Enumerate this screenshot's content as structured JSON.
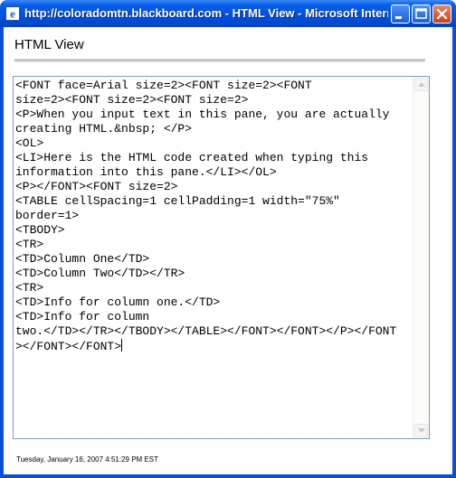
{
  "window": {
    "title": "http://coloradomtn.blackboard.com - HTML View - Microsoft Internet Explorer",
    "controls": [
      "minimize",
      "maximize",
      "close"
    ]
  },
  "page": {
    "heading": "HTML View"
  },
  "editor": {
    "lines": [
      "<FONT face=Arial size=2><FONT size=2><FONT",
      "size=2><FONT size=2><FONT size=2>",
      "<P>When you input text in this pane, you are actually",
      "creating HTML.&nbsp; </P>",
      "<OL>",
      "<LI>Here is the HTML code created when typing this",
      "information into this pane.</LI></OL>",
      "<P></FONT><FONT size=2>",
      "<TABLE cellSpacing=1 cellPadding=1 width=\"75%\"",
      "border=1>",
      "<TBODY>",
      "<TR>",
      "<TD>Column One</TD>",
      "<TD>Column Two</TD></TR>",
      "<TR>",
      "<TD>Info for column one.</TD>",
      "<TD>Info for column",
      "two.</TD></TR></TBODY></TABLE></FONT></FONT></P></FONT",
      "></FONT></FONT>"
    ]
  },
  "footer": {
    "timestamp": "Tuesday, January 16, 2007 4:51:29 PM EST"
  },
  "colors": {
    "titlebar": "#0054e3",
    "editor_border": "#7f9db9"
  },
  "icons": {
    "app": "ie-icon",
    "minimize": "minimize-icon",
    "maximize": "maximize-icon",
    "close": "close-icon",
    "scroll_up": "scroll-up-arrow-icon",
    "scroll_down": "scroll-down-arrow-icon"
  }
}
